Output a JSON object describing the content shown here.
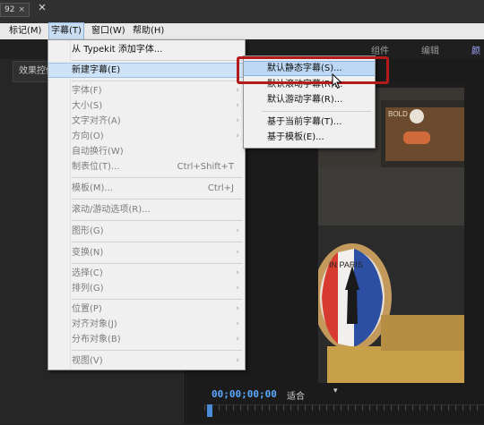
{
  "window": {
    "tab_title": "92",
    "close_glyph": "✕"
  },
  "menubar": [
    {
      "label": "标记(M)"
    },
    {
      "label": "字幕(T)"
    },
    {
      "label": "窗口(W)"
    },
    {
      "label": "帮助(H)"
    }
  ],
  "workspaces": [
    "组件",
    "编辑",
    "颜色"
  ],
  "left_panel": {
    "tab_label": "效果控件"
  },
  "title_menu": {
    "typekit": "从 Typekit 添加字体...",
    "new_title": "新建字幕(E)",
    "font": "字体(F)",
    "size": "大小(S)",
    "align": "文字对齐(A)",
    "orientation": "方向(O)",
    "word_wrap": "自动换行(W)",
    "tab_stops": "制表位(T)...",
    "tab_stops_sc": "Ctrl+Shift+T",
    "templates": "模板(M)...",
    "templates_sc": "Ctrl+J",
    "roll_crawl": "滚动/游动选项(R)...",
    "graphic": "图形(G)",
    "transform": "变换(N)",
    "select": "选择(C)",
    "arrange": "排列(G)",
    "position": "位置(P)",
    "align_objects": "对齐对象(J)",
    "distribute": "分布对象(B)",
    "view": "视图(V)"
  },
  "submenu": {
    "still": "默认静态字幕(S)...",
    "roll": "默认滚动字幕(R)...",
    "crawl": "默认游动字幕(R)...",
    "based_on": "基于当前字幕(T)...",
    "template": "基于模板(E)..."
  },
  "monitor": {
    "timecode": "00;00;00;00",
    "fit": "适合",
    "video_text_1": "IN PARIS",
    "video_text_2": "BOLD"
  },
  "colors": {
    "highlight": "#cfe3f8",
    "annotation_red": "#b31b1b",
    "timecode": "#5aa8ff"
  }
}
